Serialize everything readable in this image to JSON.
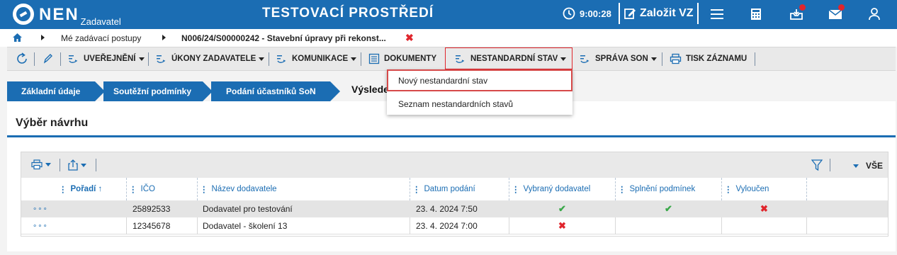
{
  "header": {
    "logo_text": "NEN",
    "logo_sub": "Zadavatel",
    "env_title": "TESTOVACÍ PROSTŘEDÍ",
    "time": "9:00:28",
    "create_label": "Založit VZ"
  },
  "breadcrumb": {
    "item1": "Mé zadávací postupy",
    "item2": "N006/24/S00000242 - Stavební úpravy při rekonst...",
    "close": "✖"
  },
  "toolbar": {
    "uverejneni": "UVEŘEJNĚNÍ",
    "ukony": "ÚKONY ZADAVATELE",
    "komunikace": "KOMUNIKACE",
    "dokumenty": "DOKUMENTY",
    "nestandardni": "NESTANDARDNÍ STAV",
    "sprava": "SPRÁVA SON",
    "tisk": "TISK ZÁZNAMU"
  },
  "dropdown": {
    "items": [
      "Nový nestandardní stav",
      "Seznam nestandardních stavů"
    ]
  },
  "tabs": {
    "items": [
      "Základní údaje",
      "Soutěžní podmínky",
      "Podání účastníků SoN"
    ],
    "active": "Výslede"
  },
  "panel": {
    "title": "Výběr návrhu"
  },
  "grid": {
    "all_label": "VŠE",
    "columns": [
      "Pořadí ↑",
      "IČO",
      "Název dodavatele",
      "Datum podání",
      "Vybraný dodavatel",
      "Splnění podmínek",
      "Vyloučen"
    ],
    "rows": [
      {
        "more": "∘∘∘",
        "ico": "25892533",
        "name": "Dodavatel pro testování",
        "date": "23. 4. 2024 7:50",
        "selected": "✔",
        "conditions": "✔",
        "excluded": "✖"
      },
      {
        "more": "∘∘∘",
        "ico": "12345678",
        "name": "Dodavatel - školení 13",
        "date": "23. 4. 2024 7:00",
        "selected": "✖",
        "conditions": "",
        "excluded": ""
      }
    ]
  },
  "colors": {
    "brand": "#1b6db3",
    "alert": "#e0252c",
    "ok": "#3aa84a"
  }
}
